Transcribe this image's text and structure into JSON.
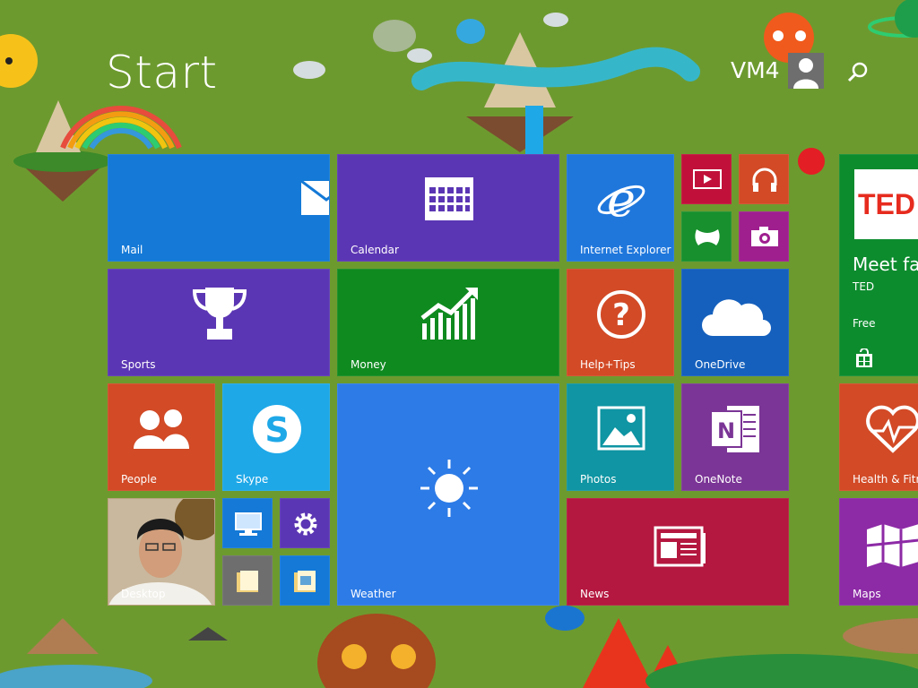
{
  "header": {
    "title": "Start",
    "user_name": "VM4"
  },
  "colors": {
    "background": "#6d9a2f",
    "mail": "#1479d7",
    "calendar": "#5b36b4",
    "ie": "#1f77dc",
    "video": "#c1113a",
    "music": "#d24a26",
    "games": "#17902d",
    "camera": "#9f1f8f",
    "sports": "#5b36b4",
    "money": "#0f8a1f",
    "help": "#d24a26",
    "onedrive": "#1560bd",
    "people": "#d24a26",
    "skype": "#1ea8e8",
    "weather": "#2d7be7",
    "photos": "#0f95a3",
    "onenote": "#7b3596",
    "news": "#b4173f",
    "store": "#0d8c2e",
    "health": "#d24a26",
    "maps": "#8d2aa6",
    "pc": "#1479d7",
    "settings": "#5b36b4",
    "files": "#6e6e6e",
    "folder": "#1479d7"
  },
  "tiles": {
    "mail": {
      "label": "Mail",
      "icon": "mail-icon"
    },
    "calendar": {
      "label": "Calendar",
      "icon": "calendar-icon"
    },
    "ie": {
      "label": "Internet Explorer",
      "icon": "ie-icon"
    },
    "video": {
      "icon": "video-icon"
    },
    "music": {
      "icon": "headphones-icon"
    },
    "games": {
      "icon": "gamepad-icon"
    },
    "camera": {
      "icon": "camera-icon"
    },
    "sports": {
      "label": "Sports",
      "icon": "trophy-icon"
    },
    "money": {
      "label": "Money",
      "icon": "chart-icon"
    },
    "help": {
      "label": "Help+Tips",
      "icon": "question-icon"
    },
    "onedrive": {
      "label": "OneDrive",
      "icon": "cloud-icon"
    },
    "people": {
      "label": "People",
      "icon": "people-icon"
    },
    "skype": {
      "label": "Skype",
      "icon": "skype-icon"
    },
    "weather": {
      "label": "Weather",
      "icon": "sun-icon"
    },
    "photos": {
      "label": "Photos",
      "icon": "photo-icon"
    },
    "onenote": {
      "label": "OneNote",
      "icon": "onenote-icon"
    },
    "desktop": {
      "label": "Desktop"
    },
    "news": {
      "label": "News",
      "icon": "newspaper-icon"
    },
    "store": {
      "logo": "TED",
      "headline": "Meet fas",
      "app": "TED",
      "price": "Free",
      "icon": "store-icon"
    },
    "health": {
      "label": "Health & Fitne",
      "icon": "heartbeat-icon"
    },
    "maps": {
      "label": "Maps",
      "icon": "map-icon"
    }
  }
}
